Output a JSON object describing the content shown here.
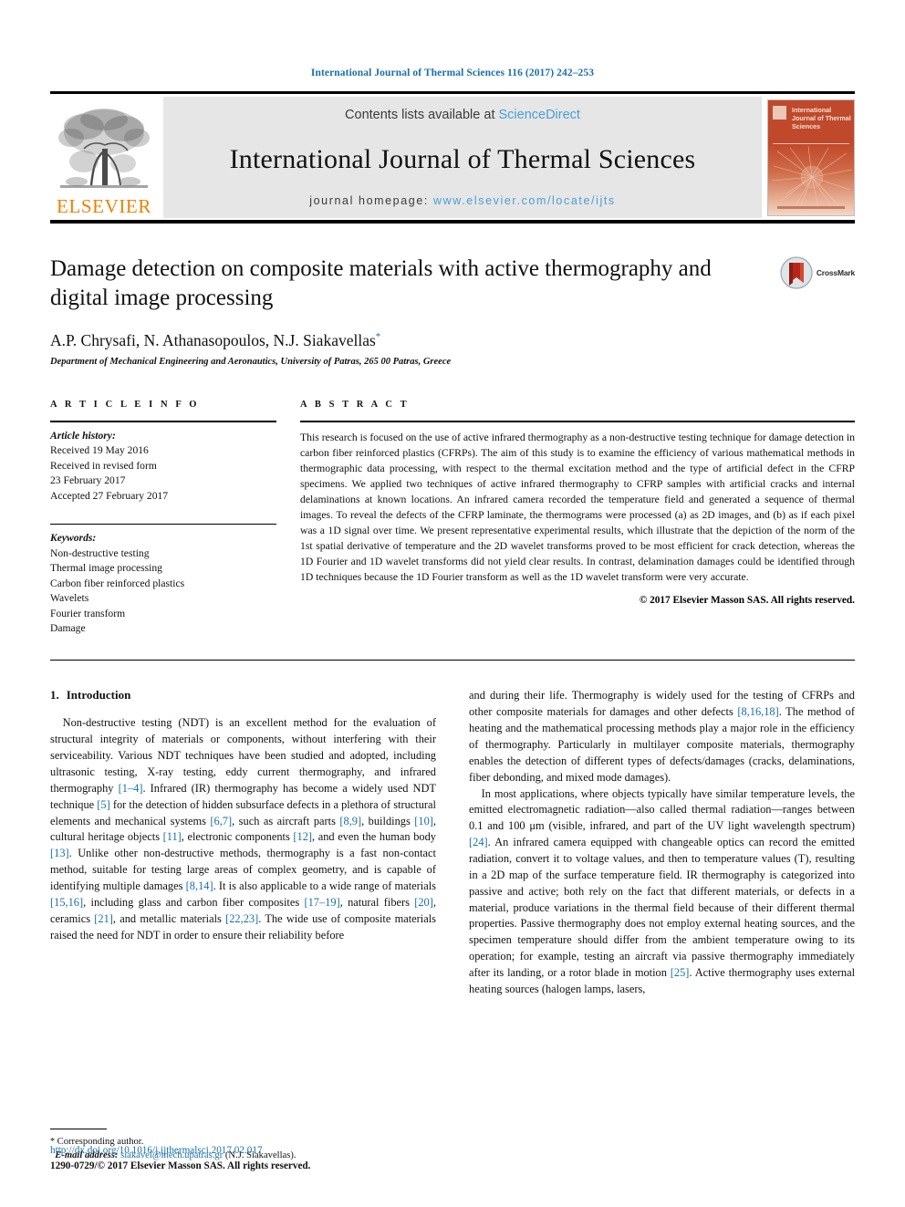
{
  "running_head": "International Journal of Thermal Sciences 116 (2017) 242–253",
  "masthead": {
    "contents_prefix": "Contents lists available at ",
    "sciencedirect": "ScienceDirect",
    "journal_name": "International Journal of Thermal Sciences",
    "homepage_prefix": "journal homepage: ",
    "homepage_url": "www.elsevier.com/locate/ijts",
    "publisher_logo_text": "ELSEVIER",
    "cover_title": "International Journal of Thermal Sciences",
    "accent_orange": "#f08000",
    "link_blue": "#4a9fd4",
    "cover_red": "#c0492b"
  },
  "article": {
    "title": "Damage detection on composite materials with active thermography and digital image processing",
    "crossmark_label": "CrossMark",
    "authors": "A.P. Chrysafi, N. Athanasopoulos, N.J. Siakavellas",
    "corresponding_marker": "*",
    "affiliation": "Department of Mechanical Engineering and Aeronautics, University of Patras, 265 00 Patras, Greece"
  },
  "article_info": {
    "heading": "A R T I C L E   I N F O",
    "history_label": "Article history:",
    "history_lines": [
      "Received 19 May 2016",
      "Received in revised form",
      "23 February 2017",
      "Accepted 27 February 2017"
    ],
    "keywords_label": "Keywords:",
    "keywords": [
      "Non-destructive testing",
      "Thermal image processing",
      "Carbon fiber reinforced plastics",
      "Wavelets",
      "Fourier transform",
      "Damage"
    ]
  },
  "abstract": {
    "heading": "A B S T R A C T",
    "text": "This research is focused on the use of active infrared thermography as a non-destructive testing technique for damage detection in carbon fiber reinforced plastics (CFRPs). The aim of this study is to examine the efficiency of various mathematical methods in thermographic data processing, with respect to the thermal excitation method and the type of artificial defect in the CFRP specimens. We applied two techniques of active infrared thermography to CFRP samples with artificial cracks and internal delaminations at known locations. An infrared camera recorded the temperature field and generated a sequence of thermal images. To reveal the defects of the CFRP laminate, the thermograms were processed (a) as 2D images, and (b) as if each pixel was a 1D signal over time. We present representative experimental results, which illustrate that the depiction of the norm of the 1st spatial derivative of temperature and the 2D wavelet transforms proved to be most efficient for crack detection, whereas the 1D Fourier and 1D wavelet transforms did not yield clear results. In contrast, delamination damages could be identified through 1D techniques because the 1D Fourier transform as well as the 1D wavelet transform were very accurate.",
    "copyright": "© 2017 Elsevier Masson SAS. All rights reserved."
  },
  "body": {
    "section_number": "1.",
    "section_title": "Introduction",
    "left_col_paragraph_1_part1": "Non-destructive testing (NDT) is an excellent method for the evaluation of structural integrity of materials or components, without interfering with their serviceability. Various NDT techniques have been studied and adopted, including ultrasonic testing, X-ray testing, eddy current thermography, and infrared thermography ",
    "ref_1_4": "[1–4]",
    "left_col_paragraph_1_part2": ". Infrared (IR) thermography has become a widely used NDT technique ",
    "ref_5": "[5]",
    "left_col_paragraph_1_part3": " for the detection of hidden subsurface defects in a plethora of structural elements and mechanical systems ",
    "ref_6_7": "[6,7]",
    "left_col_paragraph_1_part4": ", such as aircraft parts ",
    "ref_8_9": "[8,9]",
    "left_col_paragraph_1_part5": ", buildings ",
    "ref_10": "[10]",
    "left_col_paragraph_1_part6": ", cultural heritage objects ",
    "ref_11": "[11]",
    "left_col_paragraph_1_part7": ", electronic components ",
    "ref_12": "[12]",
    "left_col_paragraph_1_part8": ", and even the human body ",
    "ref_13": "[13]",
    "left_col_paragraph_1_part9": ". Unlike other non-destructive methods, thermography is a fast non-contact method, suitable for testing large areas of complex geometry, and is capable of identifying multiple damages ",
    "ref_8_14": "[8,14]",
    "left_col_paragraph_1_part10": ". It is also applicable to a wide range of materials ",
    "ref_15_16": "[15,16]",
    "left_col_paragraph_1_part11": ", including glass and carbon fiber composites ",
    "ref_17_19": "[17–19]",
    "left_col_paragraph_1_part12": ", natural fibers ",
    "ref_20": "[20]",
    "left_col_paragraph_1_part13": ", ceramics ",
    "ref_21": "[21]",
    "left_col_paragraph_1_part14": ", and metallic materials ",
    "ref_22_23": "[22,23]",
    "left_col_paragraph_1_part15": ". The wide use of composite materials raised the need for NDT in order to ensure their reliability before",
    "right_col_p1_part1": "and during their life. Thermography is widely used for the testing of CFRPs and other composite materials for damages and other defects ",
    "ref_8_16_18": "[8,16,18]",
    "right_col_p1_part2": ". The method of heating and the mathematical processing methods play a major role in the efficiency of thermography. Particularly in multilayer composite materials, thermography enables the detection of different types of defects/damages (cracks, delaminations, fiber debonding, and mixed mode damages).",
    "right_col_p2_part1": "In most applications, where objects typically have similar temperature levels, the emitted electromagnetic radiation—also called thermal radiation—ranges between 0.1 and 100 μm (visible, infrared, and part of the UV light wavelength spectrum) ",
    "ref_24": "[24]",
    "right_col_p2_part2": ". An infrared camera equipped with changeable optics can record the emitted radiation, convert it to voltage values, and then to temperature values (T), resulting in a 2D map of the surface temperature field. IR thermography is categorized into passive and active; both rely on the fact that different materials, or defects in a material, produce variations in the thermal field because of their different thermal properties. Passive thermography does not employ external heating sources, and the specimen temperature should differ from the ambient temperature owing to its operation; for example, testing an aircraft via passive thermography immediately after its landing, or a rotor blade in motion ",
    "ref_25": "[25]",
    "right_col_p2_part3": ". Active thermography uses external heating sources (halogen lamps, lasers,"
  },
  "footnote": {
    "star": "*",
    "corresponding": " Corresponding author.",
    "email_label": "E-mail address:",
    "email": "siakavel@mech.upatras.gr",
    "email_suffix": " (N.J. Siakavellas)."
  },
  "page_footer": {
    "doi": "http://dx.doi.org/10.1016/j.ijthermalsci.2017.02.017",
    "issn_line": "1290-0729/© 2017 Elsevier Masson SAS. All rights reserved."
  }
}
